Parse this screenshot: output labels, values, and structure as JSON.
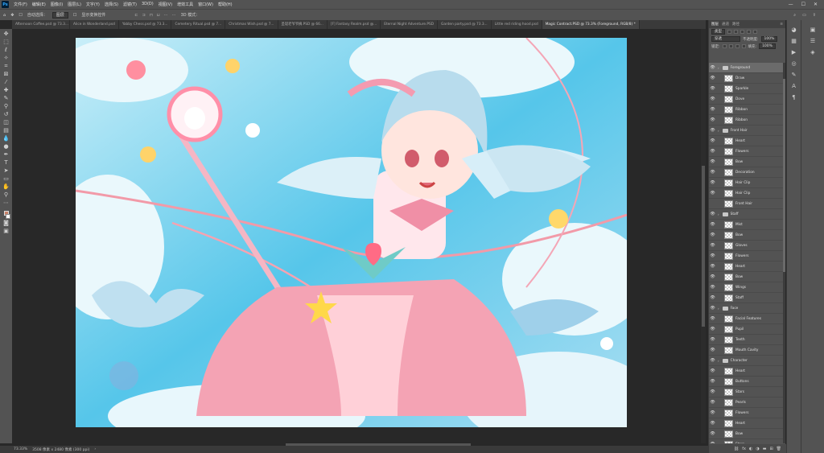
{
  "menubar": {
    "logo": "Ps",
    "items": [
      "文件(F)",
      "编辑(E)",
      "图像(I)",
      "图层(L)",
      "文字(Y)",
      "选择(S)",
      "滤镜(T)",
      "3D(D)",
      "视图(V)",
      "增效工具",
      "窗口(W)",
      "帮助(H)"
    ]
  },
  "options": {
    "auto_select": "自动选择：",
    "auto_select_value": "图层",
    "show_transform": "显示变换控件",
    "mode_3d": "3D 模式："
  },
  "tabs": [
    "Afternoon Coffee.psd @ 73.3...",
    "Alice in Wonderland.psd",
    "Yabby Chess.psd @ 73.3...",
    "Cemetery Ritual.psd @ 7...",
    "Christmas Wish.psd @ 7...",
    "圣诞老爷爷摘.PSD @ 66...",
    "[F] Fantasy Realm.psd @...",
    "Eternal Night Adventure.PSD",
    "Garden party.psd @ 73.3...",
    "Little red riding hood.psd",
    "Magic Contract.PSD @ 73.3% (Foreground, RGB/8) *"
  ],
  "status": {
    "zoom": "73.33%",
    "doc_size": "3508 像素 x 2480 像素 (300 ppi)"
  },
  "layers_panel": {
    "tab_layers": "图层",
    "tab_channels": "通道",
    "tab_paths": "路径",
    "filter_kind": "类型",
    "blend_mode": "穿透",
    "opacity_label": "不透明度:",
    "opacity_value": "100%",
    "lock_label": "锁定:",
    "fill_label": "填充:",
    "fill_value": "100%"
  },
  "layers": [
    {
      "name": "Foreground",
      "group": true,
      "selected": true,
      "visible": true
    },
    {
      "name": "Draw",
      "group": false,
      "visible": true
    },
    {
      "name": "Sparkle",
      "group": false,
      "visible": true
    },
    {
      "name": "Dove",
      "group": false,
      "visible": true
    },
    {
      "name": "Ribbon",
      "group": false,
      "visible": true
    },
    {
      "name": "Ribbon",
      "group": false,
      "visible": true
    },
    {
      "name": "Front Hair",
      "group": true,
      "visible": true
    },
    {
      "name": "Heart",
      "group": false,
      "visible": true
    },
    {
      "name": "Flowers",
      "group": false,
      "visible": true
    },
    {
      "name": "Bow",
      "group": false,
      "visible": true
    },
    {
      "name": "Decoration",
      "group": false,
      "visible": true
    },
    {
      "name": "Hair Clip",
      "group": false,
      "visible": true
    },
    {
      "name": "Hair Clip",
      "group": false,
      "visible": true
    },
    {
      "name": "Front Hair",
      "group": false,
      "visible": false
    },
    {
      "name": "Staff",
      "group": true,
      "visible": true
    },
    {
      "name": "Mist",
      "group": false,
      "visible": true
    },
    {
      "name": "Bow",
      "group": false,
      "visible": true
    },
    {
      "name": "Gloves",
      "group": false,
      "visible": true
    },
    {
      "name": "Flowers",
      "group": false,
      "visible": true
    },
    {
      "name": "Heart",
      "group": false,
      "visible": true
    },
    {
      "name": "Bow",
      "group": false,
      "visible": true
    },
    {
      "name": "Wings",
      "group": false,
      "visible": true
    },
    {
      "name": "Staff",
      "group": false,
      "visible": true
    },
    {
      "name": "Face",
      "group": true,
      "visible": true
    },
    {
      "name": "Facial Features",
      "group": false,
      "visible": true
    },
    {
      "name": "Pupil",
      "group": false,
      "visible": true
    },
    {
      "name": "Teeth",
      "group": false,
      "visible": true
    },
    {
      "name": "Mouth Cavity",
      "group": false,
      "visible": true
    },
    {
      "name": "Character",
      "group": true,
      "visible": true
    },
    {
      "name": "Heart",
      "group": false,
      "visible": true
    },
    {
      "name": "Buttons",
      "group": false,
      "visible": true
    },
    {
      "name": "Stars",
      "group": false,
      "visible": true
    },
    {
      "name": "Pearls",
      "group": false,
      "visible": true
    },
    {
      "name": "Flowers",
      "group": false,
      "visible": true
    },
    {
      "name": "Heart",
      "group": false,
      "visible": true
    },
    {
      "name": "Bow",
      "group": false,
      "visible": true
    },
    {
      "name": "Stars",
      "group": false,
      "visible": true
    }
  ],
  "colors": {
    "foreground_swatch": "#c8826a",
    "background_swatch": "#ffffff"
  }
}
